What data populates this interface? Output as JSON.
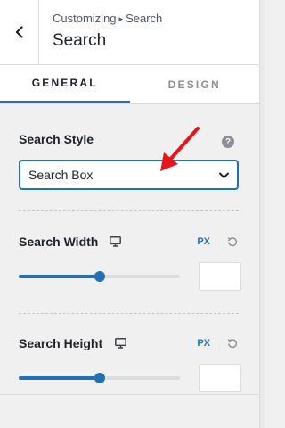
{
  "header": {
    "breadcrumb_parent": "Customizing",
    "breadcrumb_separator": "▸",
    "breadcrumb_current": "Search",
    "title": "Search"
  },
  "tabs": [
    {
      "label": "General",
      "active": true
    },
    {
      "label": "Design",
      "active": false
    }
  ],
  "search_style": {
    "label": "Search Style",
    "help": "?",
    "value": "Search Box"
  },
  "search_width": {
    "label": "Search Width",
    "unit": "PX",
    "slider_fraction": 0.5,
    "input_value": ""
  },
  "search_height": {
    "label": "Search Height",
    "unit": "PX",
    "slider_fraction": 0.5,
    "input_value": ""
  },
  "colors": {
    "accent": "#2271b1",
    "annotation_arrow": "#e8141b"
  },
  "icons": [
    "back-chevron-icon",
    "help-icon",
    "chevron-down-icon",
    "monitor-icon",
    "reset-icon"
  ]
}
